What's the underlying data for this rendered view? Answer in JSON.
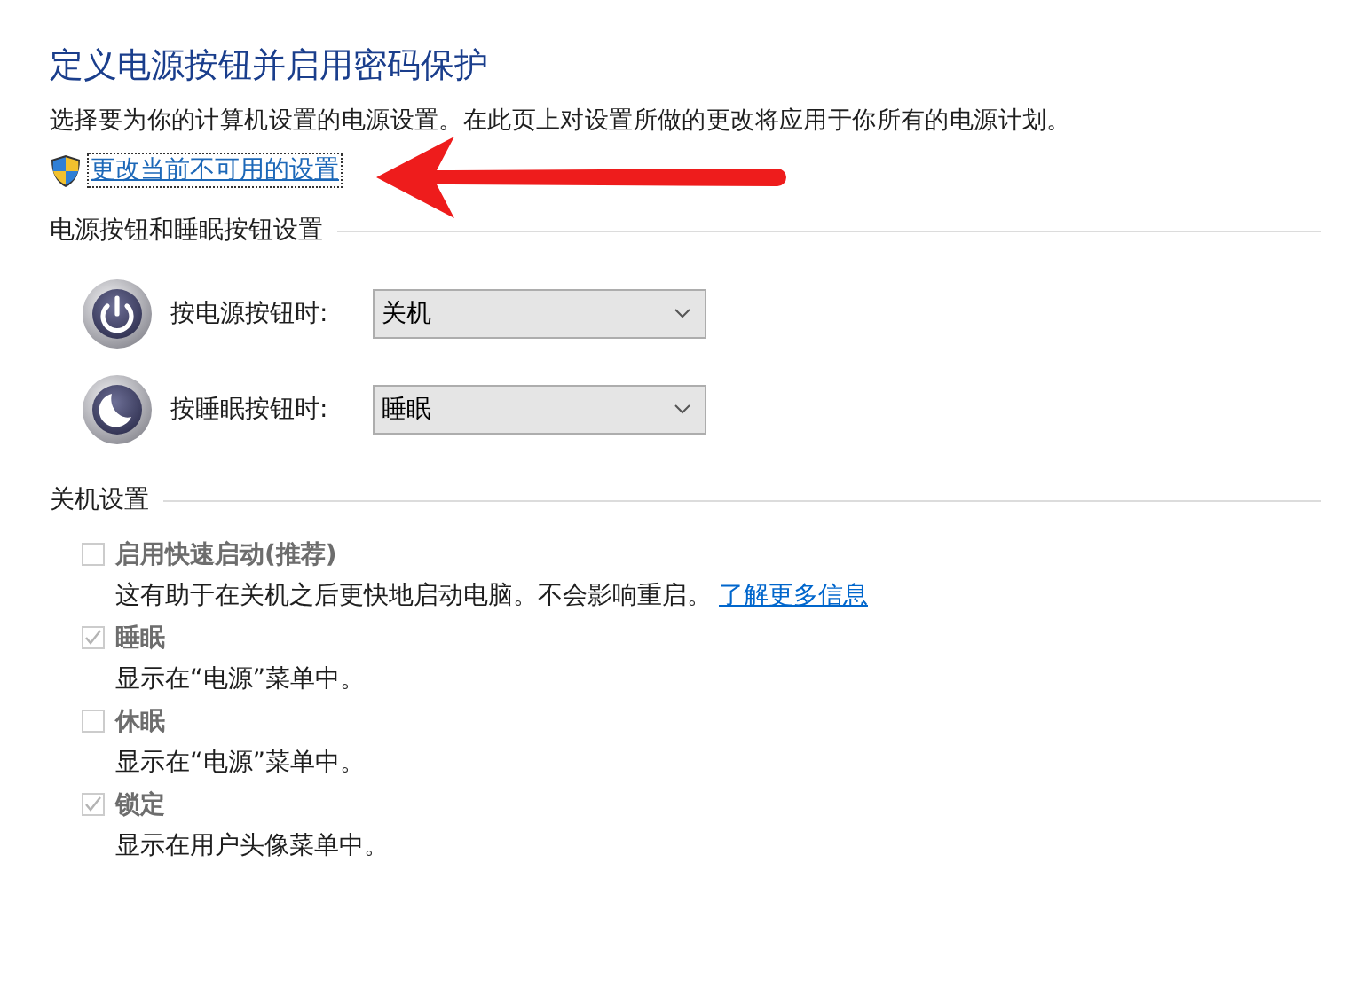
{
  "title": "定义电源按钮并启用密码保护",
  "description": "选择要为你的计算机设置的电源设置。在此页上对设置所做的更改将应用于你所有的电源计划。",
  "admin_link": {
    "label": "更改当前不可用的设置",
    "focused": true
  },
  "annotation": {
    "kind": "arrow",
    "color": "#ee1c1c"
  },
  "button_section": {
    "heading": "电源按钮和睡眠按钮设置",
    "rows": [
      {
        "kind": "power",
        "label": "按电源按钮时:",
        "value": "关机"
      },
      {
        "kind": "sleep",
        "label": "按睡眠按钮时:",
        "value": "睡眠"
      }
    ]
  },
  "shutdown_section": {
    "heading": "关机设置",
    "items": [
      {
        "label": "启用快速启动(推荐)",
        "checked": false,
        "disabled": true,
        "description": "这有助于在关机之后更快地启动电脑。不会影响重启。",
        "link": "了解更多信息"
      },
      {
        "label": "睡眠",
        "checked": true,
        "disabled": true,
        "description": "显示在“电源”菜单中。"
      },
      {
        "label": "休眠",
        "checked": false,
        "disabled": true,
        "description": "显示在“电源”菜单中。"
      },
      {
        "label": "锁定",
        "checked": true,
        "disabled": true,
        "description": "显示在用户头像菜单中。"
      }
    ]
  }
}
